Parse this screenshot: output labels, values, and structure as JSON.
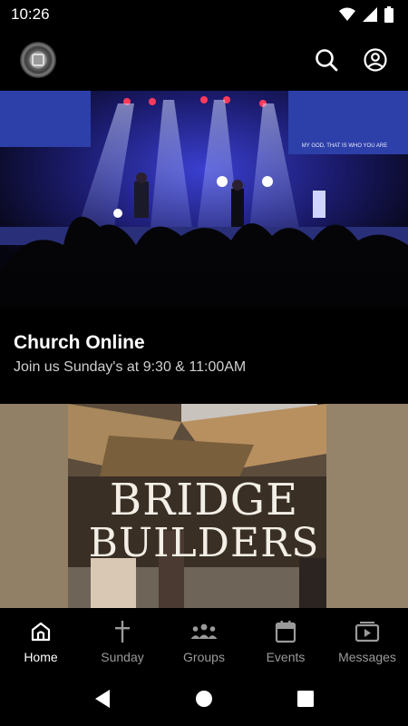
{
  "status": {
    "time": "10:26"
  },
  "hero": {
    "title": "Church Online",
    "subtitle": "Join us Sunday's at 9:30 & 11:00AM",
    "screen_text": "MY GOD, THAT IS WHO YOU ARE"
  },
  "bridge": {
    "line1": "BRIDGE",
    "line2": "BUILDERS"
  },
  "nav": {
    "items": [
      {
        "label": "Home",
        "icon": "home-icon",
        "active": true
      },
      {
        "label": "Sunday",
        "icon": "cross-icon",
        "active": false
      },
      {
        "label": "Groups",
        "icon": "groups-icon",
        "active": false
      },
      {
        "label": "Events",
        "icon": "calendar-icon",
        "active": false
      },
      {
        "label": "Messages",
        "icon": "video-icon",
        "active": false
      }
    ]
  },
  "colors": {
    "background": "#000000",
    "active": "#ffffff",
    "inactive": "#9a9a9a",
    "subtitle": "#cfcfcf"
  }
}
